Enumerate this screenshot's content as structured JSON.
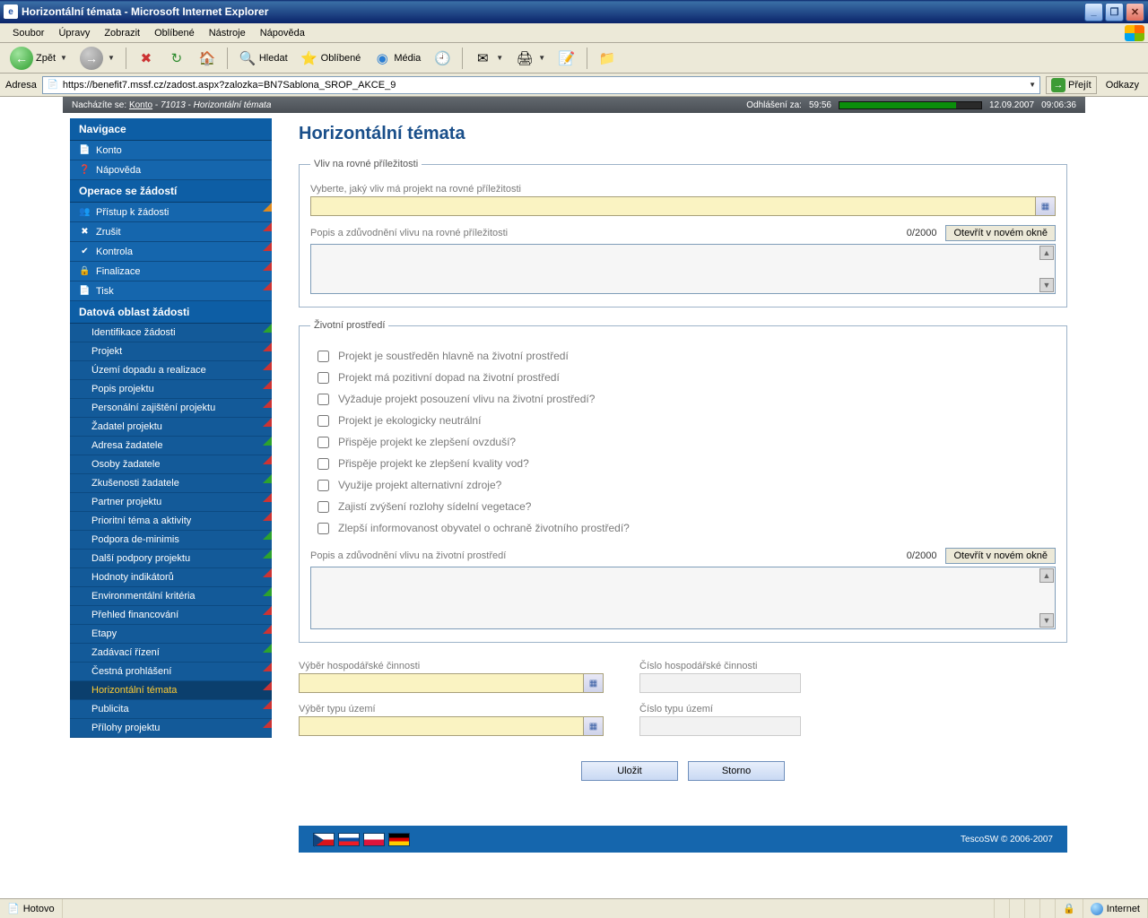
{
  "window": {
    "title": "Horizontální témata - Microsoft Internet Explorer"
  },
  "menubar": [
    "Soubor",
    "Úpravy",
    "Zobrazit",
    "Oblíbené",
    "Nástroje",
    "Nápověda"
  ],
  "toolbar": {
    "back": "Zpět",
    "search": "Hledat",
    "favorites": "Oblíbené",
    "media": "Média"
  },
  "addressbar": {
    "label": "Adresa",
    "url": "https://benefit7.mssf.cz/zadost.aspx?zalozka=BN7Sablona_SROP_AKCE_9",
    "go": "Přejít",
    "links": "Odkazy"
  },
  "breadcrumb": {
    "prefix": "Nacházíte se:",
    "konto": "Konto",
    "id": "71013",
    "page": "Horizontální témata",
    "logout_label": "Odhlášení za:",
    "logout_time": "59:56",
    "date": "12.09.2007",
    "time": "09:06:36"
  },
  "sidebar": {
    "nav_header": "Navigace",
    "nav_items": [
      {
        "icon": "📄",
        "label": "Konto"
      },
      {
        "icon": "❓",
        "label": "Nápověda"
      }
    ],
    "ops_header": "Operace se žádostí",
    "ops_items": [
      {
        "icon": "👥",
        "label": "Přístup k žádosti",
        "slash": "orange"
      },
      {
        "icon": "✖",
        "label": "Zrušit",
        "slash": "red"
      },
      {
        "icon": "✔",
        "label": "Kontrola",
        "slash": "red"
      },
      {
        "icon": "🔒",
        "label": "Finalizace",
        "slash": "red"
      },
      {
        "icon": "📄",
        "label": "Tisk",
        "slash": "red"
      }
    ],
    "data_header": "Datová oblast žádosti",
    "data_items": [
      {
        "label": "Identifikace žádosti",
        "slash": "green"
      },
      {
        "label": "Projekt",
        "slash": "red"
      },
      {
        "label": "Území dopadu a realizace",
        "slash": "red"
      },
      {
        "label": "Popis projektu",
        "slash": "red"
      },
      {
        "label": "Personální zajištění projektu",
        "slash": "red"
      },
      {
        "label": "Žadatel projektu",
        "slash": "red"
      },
      {
        "label": "Adresa žadatele",
        "slash": "green"
      },
      {
        "label": "Osoby žadatele",
        "slash": "red"
      },
      {
        "label": "Zkušenosti žadatele",
        "slash": "green"
      },
      {
        "label": "Partner projektu",
        "slash": "red"
      },
      {
        "label": "Prioritní téma a aktivity",
        "slash": "red"
      },
      {
        "label": "Podpora de-minimis",
        "slash": "green"
      },
      {
        "label": "Další podpory projektu",
        "slash": "green"
      },
      {
        "label": "Hodnoty indikátorů",
        "slash": "red"
      },
      {
        "label": "Environmentální kritéria",
        "slash": "green"
      },
      {
        "label": "Přehled financování",
        "slash": "red"
      },
      {
        "label": "Etapy",
        "slash": "red"
      },
      {
        "label": "Zadávací řízení",
        "slash": "green"
      },
      {
        "label": "Čestná prohlášení",
        "slash": "red"
      },
      {
        "label": "Horizontální témata",
        "slash": "red",
        "active": true
      },
      {
        "label": "Publicita",
        "slash": "red"
      },
      {
        "label": "Přílohy projektu",
        "slash": "red"
      }
    ]
  },
  "content": {
    "title": "Horizontální témata",
    "fs1": {
      "legend": "Vliv na rovné příležitosti",
      "label1": "Vyberte, jaký vliv má projekt na rovné příležitosti",
      "label2": "Popis a zdůvodnění vlivu na rovné příležitosti",
      "counter": "0/2000",
      "open_btn": "Otevřít v novém okně"
    },
    "fs2": {
      "legend": "Životní prostředí",
      "checks": [
        "Projekt je soustředěn hlavně na životní prostředí",
        "Projekt má pozitivní dopad na životní prostředí",
        "Vyžaduje projekt posouzení vlivu na životní prostředí?",
        "Projekt je ekologicky neutrální",
        "Přispěje projekt ke zlepšení ovzduší?",
        "Přispěje projekt ke zlepšení kvality vod?",
        "Využije projekt alternativní zdroje?",
        "Zajistí zvýšení rozlohy sídelní vegetace?",
        "Zlepší informovanost obyvatel o ochraně životního prostředí?"
      ],
      "label2": "Popis a zdůvodnění vlivu na životní prostředí",
      "counter": "0/2000",
      "open_btn": "Otevřít v novém okně"
    },
    "sel1_label": "Výběr hospodářské činnosti",
    "sel1_num": "Číslo hospodářské činnosti",
    "sel2_label": "Výběr typu území",
    "sel2_num": "Číslo typu území",
    "save_btn": "Uložit",
    "cancel_btn": "Storno"
  },
  "footer": {
    "copy": "TescoSW © 2006-2007"
  },
  "statusbar": {
    "done": "Hotovo",
    "zone": "Internet"
  }
}
